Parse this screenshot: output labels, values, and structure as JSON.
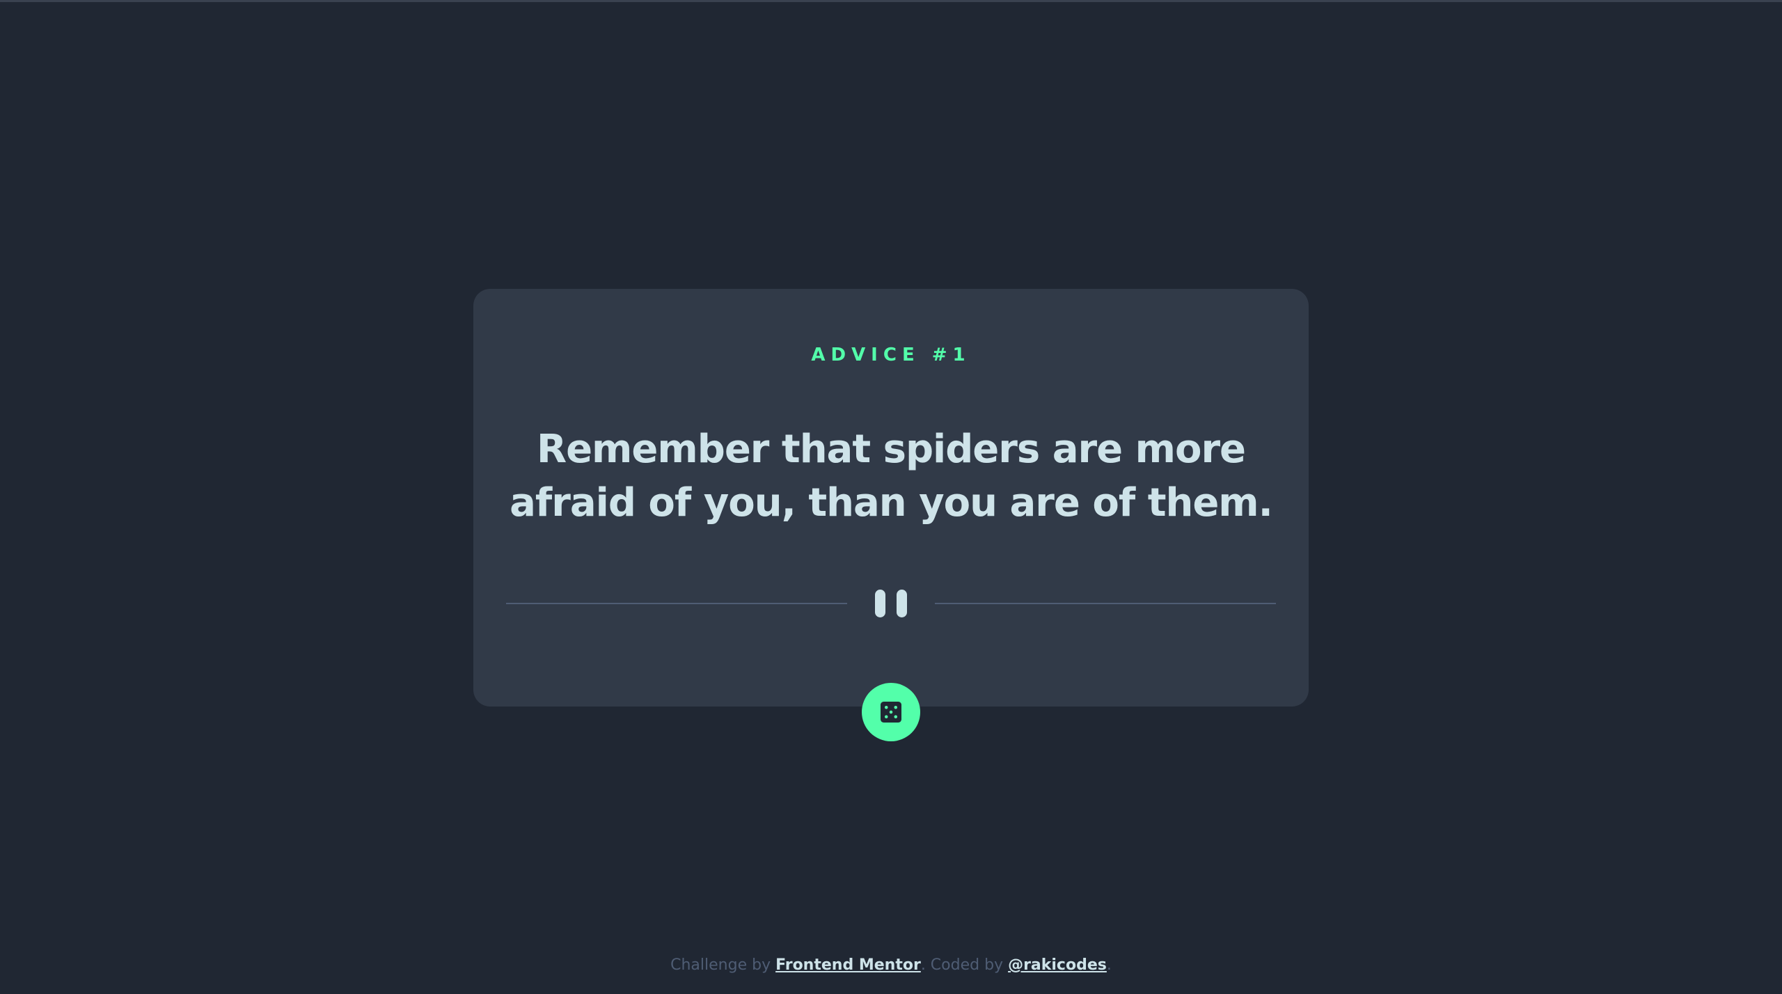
{
  "card": {
    "advice_id": "ADVICE #1",
    "quote": "Remember that spiders are more afraid of you, than you are of them."
  },
  "icons": {
    "divider": "pause-icon",
    "button": "dice-icon"
  },
  "footer": {
    "challenge_prefix": "Challenge by",
    "challenge_link": "Frontend Mentor",
    "coded_prefix": ". Coded by",
    "coded_link": "@rakicodes",
    "suffix": "."
  },
  "colors": {
    "background": "#202733",
    "card": "#313a48",
    "accent": "#53ffaa",
    "text": "#cee3e9",
    "muted": "#4f5d74"
  }
}
